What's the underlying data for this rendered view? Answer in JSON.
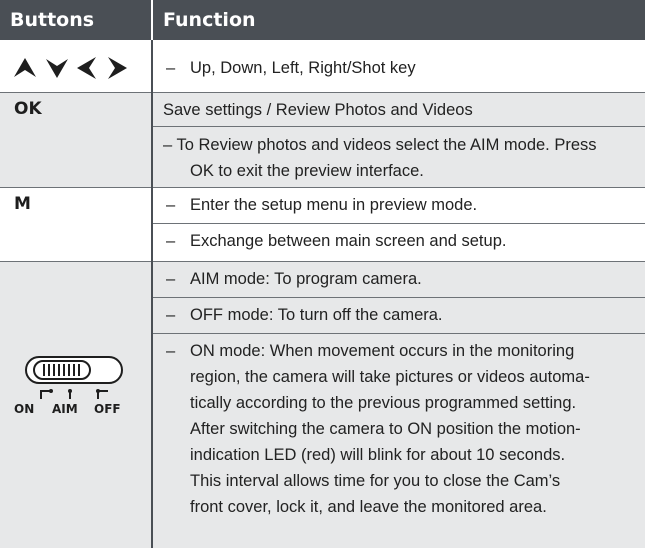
{
  "header": {
    "col1": "Buttons",
    "col2": "Function"
  },
  "rows": {
    "arrows": {
      "icon_names": [
        "up-arrow-icon",
        "down-arrow-icon",
        "left-arrow-icon",
        "right-arrow-icon"
      ],
      "dash": "–",
      "text": "Up, Down, Left, Right/Shot key"
    },
    "ok": {
      "key": "OK",
      "line1": "Save settings / Review Photos and Videos",
      "line2a": "– To Review photos and videos select the AIM mode. Press",
      "line2b": "OK to exit the preview interface."
    },
    "m": {
      "key": "M",
      "dash1": "–",
      "line1": "Enter the setup menu in preview mode.",
      "dash2": "–",
      "line2": "Exchange between main screen and setup."
    },
    "switch": {
      "icon_name": "mode-switch-icon",
      "labels": [
        "ON",
        "AIM",
        "OFF"
      ],
      "dash1": "–",
      "line1": "AIM mode: To program camera.",
      "dash2": "–",
      "line2": "OFF mode: To turn off the camera.",
      "dash3": "–",
      "line3": [
        "ON mode: When movement occurs in the monitoring",
        "region, the camera will take pictures or videos automa-",
        "tically according to the previous programmed setting.",
        "After switching the camera to ON position the motion-",
        "indication LED (red) will blink for about 10 seconds.",
        "This interval allows time for you to close the Cam’s",
        "front cover, lock it, and leave the monitored area."
      ]
    }
  },
  "colors": {
    "header_bg": "#4a4f55",
    "shade_bg": "#e7e8e9",
    "header_text": "#ffffff"
  }
}
